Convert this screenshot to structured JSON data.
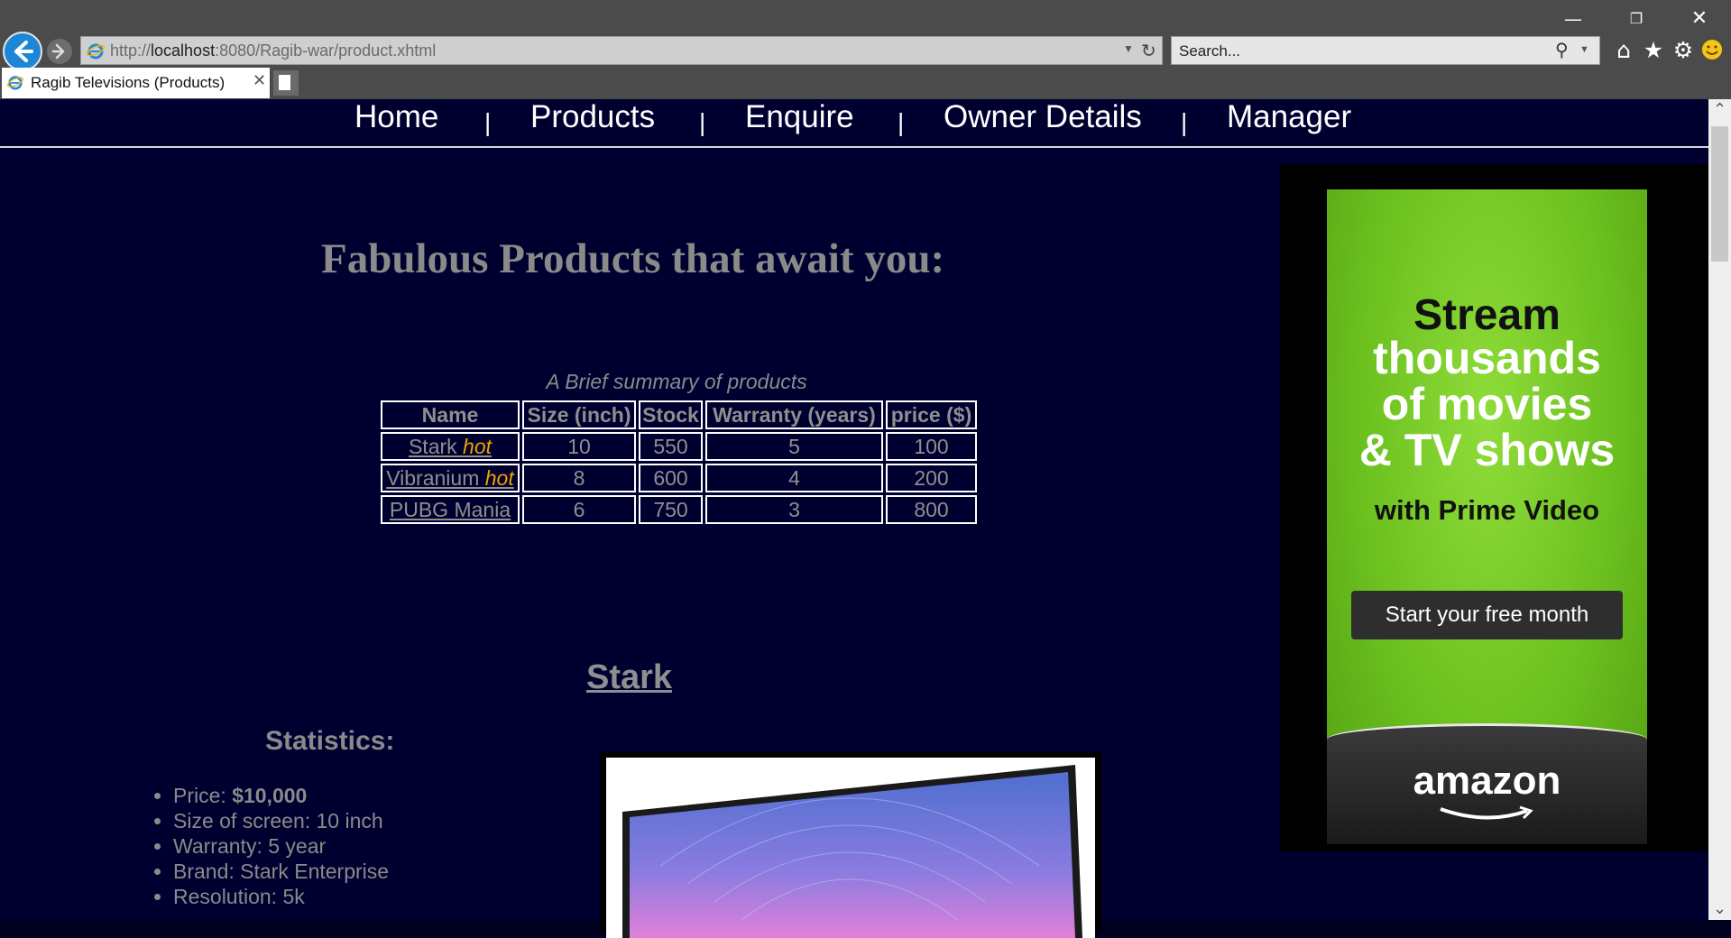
{
  "browser": {
    "url_prefix": "http://",
    "url_host": "localhost",
    "url_rest": ":8080/Ragib-war/product.xhtml",
    "search_placeholder": "Search...",
    "tab_title": "Ragib Televisions (Products)",
    "icons": [
      "back-icon",
      "forward-icon",
      "refresh-icon",
      "search-icon",
      "home-icon",
      "favorites-star-icon",
      "settings-gear-icon",
      "feedback-smiley-icon"
    ]
  },
  "nav": {
    "items": [
      "Home",
      "Products",
      "Enquire",
      "Owner Details",
      "Manager"
    ],
    "separator": "|"
  },
  "main": {
    "headline": "Fabulous Products that await you:",
    "table_caption": "A Brief summary of products",
    "table_headers": [
      "Name",
      "Size (inch)",
      "Stock",
      "Warranty (years)",
      "price ($)"
    ],
    "hot_label": "hot",
    "rows": [
      {
        "name": "Stark ",
        "hot": true,
        "size": "10",
        "stock": "550",
        "warranty": "5",
        "price": "100"
      },
      {
        "name": "Vibranium ",
        "hot": true,
        "size": "8",
        "stock": "600",
        "warranty": "4",
        "price": "200"
      },
      {
        "name": "PUBG Mania",
        "hot": false,
        "size": "6",
        "stock": "750",
        "warranty": "3",
        "price": "800"
      }
    ],
    "section_title": "Stark",
    "stats_title": "Statistics:",
    "stats": {
      "price_label": "Price: ",
      "price_value": "$10,000",
      "size": "Size of screen: 10 inch",
      "warranty": "Warranty: 5 year",
      "brand": "Brand: Stark Enterprise",
      "resolution": "Resolution: 5k"
    }
  },
  "ad": {
    "line1": "Stream",
    "line2": "thousands",
    "line3": "of movies",
    "line4": "& TV shows",
    "sub": "with Prime Video",
    "cta": "Start your free month",
    "logo": "amazon"
  },
  "colors": {
    "page_bg": "#000030",
    "hot": "#f0a000",
    "ad_green": "#6cc11f",
    "text_gray": "#8a8a8a"
  }
}
